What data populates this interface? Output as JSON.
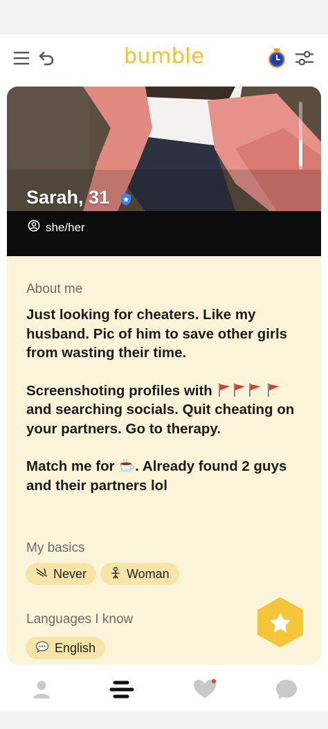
{
  "header": {
    "brand": "bumble"
  },
  "profile": {
    "name_age": "Sarah, 31",
    "pronouns": "she/her"
  },
  "about": {
    "label": "About me",
    "p1": "Just looking for cheaters. Like my husband. Pic of him to save other girls from wasting their time.",
    "p2_before": "Screenshoting profiles with",
    "p2_mid": "and searching socials. Quit cheating on your partners. Go to therapy.",
    "p3_before": "Match me for",
    "p3_after": ". Already found 2 guys and their partners lol"
  },
  "basics": {
    "label": "My basics",
    "chips": [
      {
        "icon": "smoking-icon",
        "label": "Never"
      },
      {
        "icon": "gender-icon",
        "label": "Woman"
      }
    ]
  },
  "languages": {
    "label": "Languages I know",
    "chips": [
      {
        "icon": "speech-bubble-icon",
        "label": "English"
      }
    ]
  },
  "colors": {
    "brand": "#f2c12e",
    "card_bg": "#fbf4d8",
    "chip_bg": "#f7e5a8",
    "verified": "#3b82f6",
    "notification_dot": "#e5483a"
  }
}
